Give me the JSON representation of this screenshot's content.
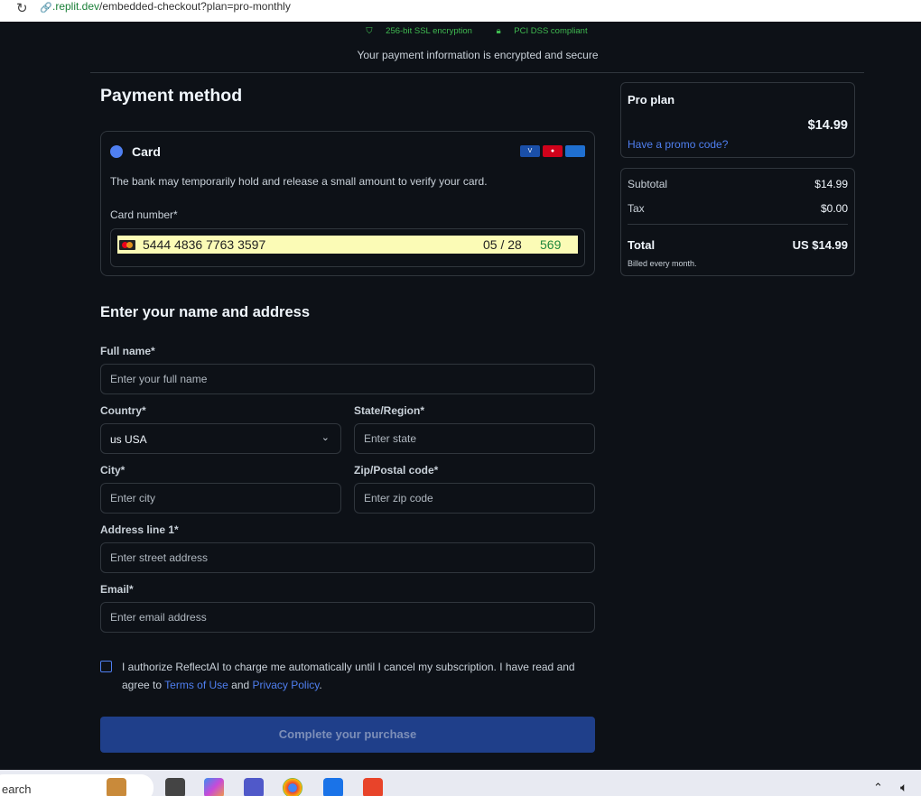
{
  "browser": {
    "url_domain": ".replit.dev",
    "url_path": "/embedded-checkout?plan=pro-monthly"
  },
  "security": {
    "ssl": "256-bit SSL encryption",
    "pci": "PCI DSS compliant",
    "note": "Your payment information is encrypted and secure"
  },
  "payment": {
    "title": "Payment method",
    "method_label": "Card",
    "brands": [
      "visa-icon",
      "mastercard-icon",
      "amex-icon"
    ],
    "note": "The bank may temporarily hold and release a small amount to verify your card.",
    "card_number_label": "Card number*",
    "card_number": "5444 4836 7763 3597",
    "expiry": "05 / 28",
    "cvc": "569"
  },
  "address": {
    "title": "Enter your name and address",
    "full_name_label": "Full name*",
    "full_name_placeholder": "Enter your full name",
    "country_label": "Country*",
    "country_value": "us USA",
    "state_label": "State/Region*",
    "state_placeholder": "Enter state",
    "city_label": "City*",
    "city_placeholder": "Enter city",
    "zip_label": "Zip/Postal code*",
    "zip_placeholder": "Enter zip code",
    "address_label": "Address line 1*",
    "address_placeholder": "Enter street address",
    "email_label": "Email*",
    "email_placeholder": "Enter email address"
  },
  "consent": {
    "text_before": "I authorize ReflectAI to charge me automatically until I cancel my subscription. I have read and agree to ",
    "terms": "Terms of Use",
    "and": " and ",
    "privacy": "Privacy Policy",
    "end": "."
  },
  "purchase_button": "Complete your purchase",
  "summary": {
    "plan_name": "Pro plan",
    "plan_price": "$14.99",
    "promo_link": "Have a promo code?",
    "subtotal_label": "Subtotal",
    "subtotal_value": "$14.99",
    "tax_label": "Tax",
    "tax_value": "$0.00",
    "total_label": "Total",
    "total_value": "US $14.99",
    "billed_note": "Billed every month."
  },
  "taskbar": {
    "search_text": "earch"
  },
  "colors": {
    "background": "#0d1117",
    "accent": "#4f7ff0",
    "secure_green": "#3fb950",
    "button_bg": "#1f3f8a"
  }
}
